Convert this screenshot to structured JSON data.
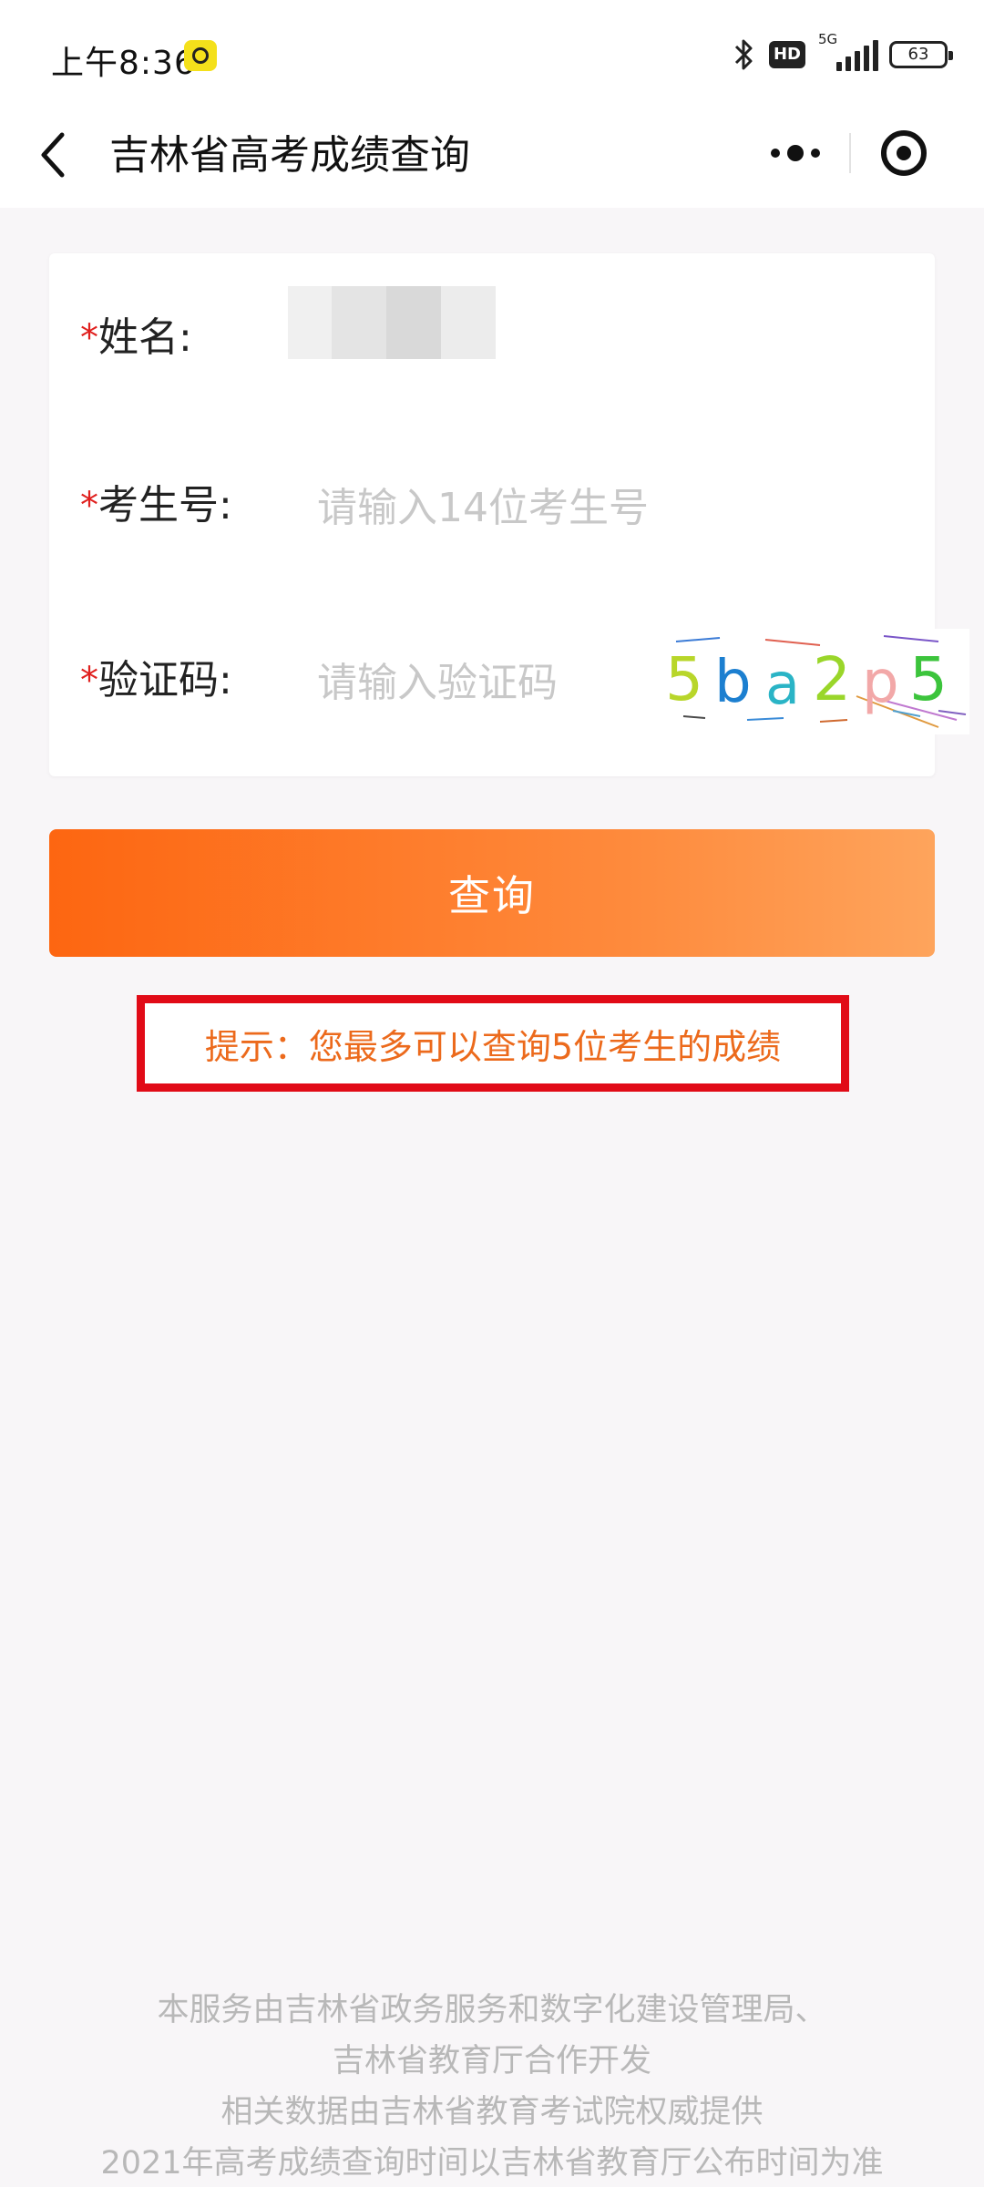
{
  "status_bar": {
    "time": "上午8:36",
    "hd": "HD",
    "network": "5G",
    "battery": "63"
  },
  "nav": {
    "title": "吉林省高考成绩查询"
  },
  "form": {
    "name": {
      "label": "姓名:",
      "value": ""
    },
    "exam_id": {
      "label": "考生号:",
      "placeholder": "请输入14位考生号"
    },
    "captcha": {
      "label": "验证码:",
      "placeholder": "请输入验证码",
      "code": "5ba2p5"
    }
  },
  "query_button": {
    "label": "查询"
  },
  "tip": {
    "text": "提示：您最多可以查询5位考生的成绩"
  },
  "footer": {
    "lines": [
      "本服务由吉林省政务服务和数字化建设管理局、",
      "吉林省教育厅合作开发",
      "相关数据由吉林省教育考试院权威提供",
      "2021年高考成绩查询时间以吉林省教育厅公布时间为准"
    ]
  },
  "colors": {
    "accent_orange": "#fd6611",
    "tip_border": "#e10b17",
    "tip_text": "#ec6a1c",
    "required_star": "#e0201e"
  }
}
